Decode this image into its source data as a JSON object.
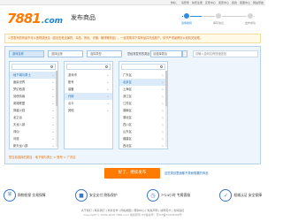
{
  "topbar": {
    "links": [
      "你好，",
      "请登录",
      "免费注册",
      "买家中心",
      "卖家中心",
      "我的",
      "客服中心",
      "网站导航"
    ]
  },
  "header": {
    "logo_number": "7881",
    "logo_domain": ".com",
    "title": "发布商品"
  },
  "steps": [
    {
      "label": "选择类别",
      "active": true
    },
    {
      "label": "填写信息",
      "active": false
    },
    {
      "label": "发布成功",
      "active": false
    }
  ],
  "notice": "1.您发布的商品不可以违规或违法（如出售枪支弹药、毒品、黄色、诈骗、赌博等商品），一经发现将下架商品并冻结账户，情节严重者移交公安机关处理。",
  "search": {
    "tabs": [
      "游戏名称",
      "选择区服",
      "选择类型"
    ],
    "label": "您经常发布的类目：",
    "input_value": "请选择类目",
    "hint": "请输入游戏名称快速查找"
  },
  "columns": [
    {
      "items": [
        "地下城与勇士",
        "魔兽世界",
        "梦幻西游",
        "剑侠情缘",
        "英雄联盟",
        "穿越火线",
        "龙之谷",
        "天龙八部",
        "诛仙",
        "问道",
        "新天龙八部",
        "倩女幽魂"
      ],
      "selected": 0
    },
    {
      "items": [
        "游戏币",
        "账号",
        "装备",
        "代练",
        "点卡",
        "其他"
      ],
      "selected": 3
    },
    {
      "items": [
        "广东区",
        "北京区",
        "上海区",
        "浙江区",
        "江苏区",
        "湖南区",
        "湖北区",
        "四川区",
        "山东区",
        "福建区",
        "西北区",
        "华北区"
      ],
      "selected": 1
    }
  ],
  "current_path": "您当前选择的类目：地下城与勇士 > 账号 > 广东区",
  "next_button": "好了，继续发布",
  "help_link": "这些类目里面都不是我想要的商品",
  "features": [
    {
      "icon": "shield-icon",
      "text": "购物担保  交易保障"
    },
    {
      "icon": "lock-icon",
      "text": "安全支付  隐私保护"
    },
    {
      "icon": "clock-icon",
      "text": "7*24小时  专属客服"
    },
    {
      "icon": "check-icon",
      "text": "权威认证  安全保障"
    }
  ],
  "footer": {
    "links": "关于我们 | 联系我们 | 商务合作 | 网站地图 | 帮助中心 | 免责声明 | 诚聘英才 | 友情链接",
    "copyright": "Copyright © 2009-2016 7881.com 版权所有  ICP备案号：苏ICP备10228466号"
  }
}
